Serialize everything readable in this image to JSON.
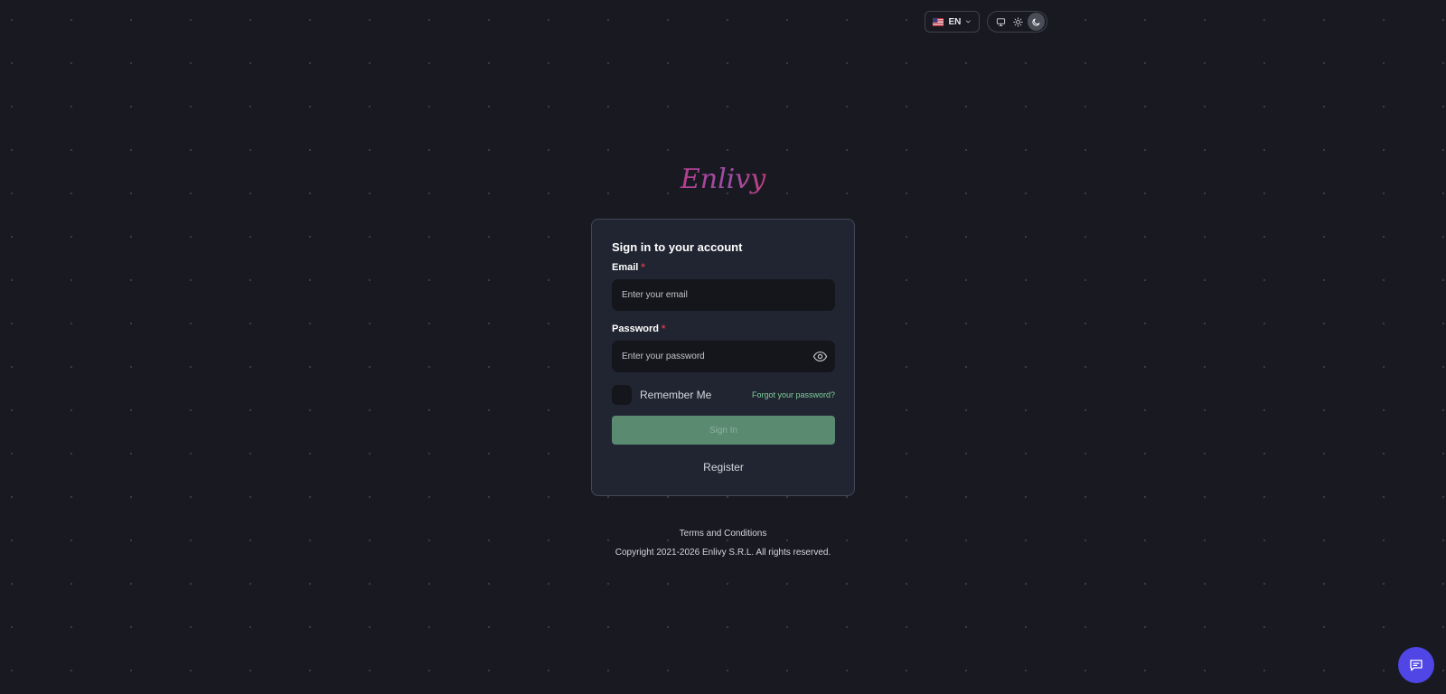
{
  "header": {
    "language": {
      "code": "EN",
      "flag_icon": "us-flag-icon"
    },
    "theme": {
      "options": [
        "system",
        "light",
        "dark"
      ],
      "selected": "dark"
    }
  },
  "brand": {
    "logo_text": "Enlivy"
  },
  "login": {
    "title": "Sign in to your account",
    "email_label": "Email",
    "email_placeholder": "Enter your email",
    "password_label": "Password",
    "password_placeholder": "Enter your password",
    "required_mark": "*",
    "remember_label": "Remember Me",
    "forgot_label": "Forgot your password?",
    "signin_label": "Sign In",
    "register_label": "Register"
  },
  "footer": {
    "terms_label": "Terms and Conditions",
    "copyright": "Copyright 2021-2026 Enlivy S.R.L. All rights reserved."
  },
  "colors": {
    "background": "#191a21",
    "card": "#212532",
    "primary": "#5a8a70",
    "link": "#7fcf9a",
    "chat": "#4f46e5"
  }
}
